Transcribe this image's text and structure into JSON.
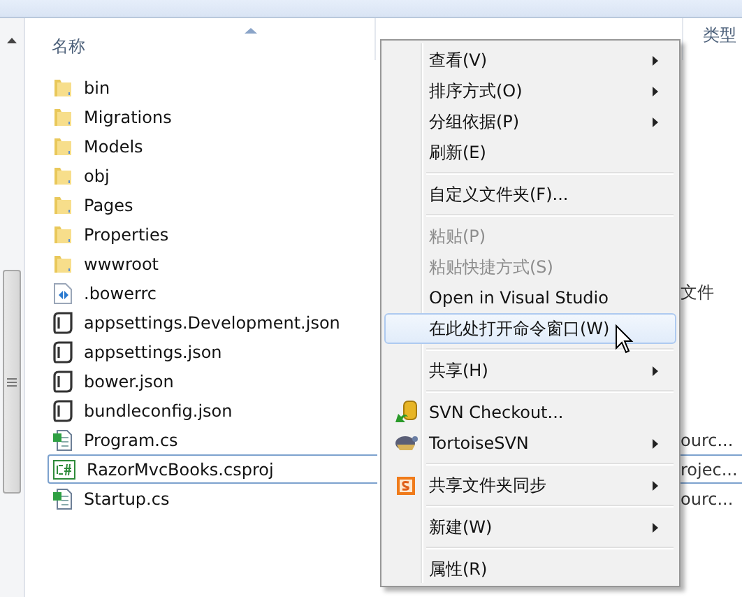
{
  "columns": [
    {
      "label": "名称",
      "kind": "name"
    },
    {
      "label": "类型",
      "kind": "type"
    }
  ],
  "files": [
    {
      "name": "bin",
      "kind": "folder",
      "selected": false
    },
    {
      "name": "Migrations",
      "kind": "folder",
      "selected": false
    },
    {
      "name": "Models",
      "kind": "folder",
      "selected": false
    },
    {
      "name": "obj",
      "kind": "folder",
      "selected": false
    },
    {
      "name": "Pages",
      "kind": "folder",
      "selected": false
    },
    {
      "name": "Properties",
      "kind": "folder",
      "selected": false
    },
    {
      "name": "wwwroot",
      "kind": "folder",
      "selected": false
    },
    {
      "name": ".bowerrc",
      "kind": "code",
      "selected": false,
      "type": "文件"
    },
    {
      "name": "appsettings.Development.json",
      "kind": "json",
      "selected": false
    },
    {
      "name": "appsettings.json",
      "kind": "json",
      "selected": false
    },
    {
      "name": "bower.json",
      "kind": "json",
      "selected": false
    },
    {
      "name": "bundleconfig.json",
      "kind": "json",
      "selected": false
    },
    {
      "name": "Program.cs",
      "kind": "csharp",
      "selected": false,
      "type": "ourc..."
    },
    {
      "name": "RazorMvcBooks.csproj",
      "kind": "csproj",
      "selected": true,
      "type": "rojec..."
    },
    {
      "name": "Startup.cs",
      "kind": "csharp",
      "selected": false,
      "type": "ourc..."
    }
  ],
  "context_menu": [
    {
      "kind": "item",
      "label": "查看(V)",
      "submenu": true,
      "disabled": false,
      "selected": false
    },
    {
      "kind": "item",
      "label": "排序方式(O)",
      "submenu": true,
      "disabled": false,
      "selected": false
    },
    {
      "kind": "item",
      "label": "分组依据(P)",
      "submenu": true,
      "disabled": false,
      "selected": false
    },
    {
      "kind": "item",
      "label": "刷新(E)",
      "submenu": false,
      "disabled": false,
      "selected": false
    },
    {
      "kind": "separator"
    },
    {
      "kind": "item",
      "label": "自定义文件夹(F)...",
      "submenu": false,
      "disabled": false,
      "selected": false
    },
    {
      "kind": "separator"
    },
    {
      "kind": "item",
      "label": "粘贴(P)",
      "submenu": false,
      "disabled": true,
      "selected": false
    },
    {
      "kind": "item",
      "label": "粘贴快捷方式(S)",
      "submenu": false,
      "disabled": true,
      "selected": false
    },
    {
      "kind": "item",
      "label": "Open in Visual Studio",
      "submenu": false,
      "disabled": false,
      "selected": false
    },
    {
      "kind": "item",
      "label": "在此处打开命令窗口(W)",
      "submenu": false,
      "disabled": false,
      "selected": true
    },
    {
      "kind": "separator"
    },
    {
      "kind": "item",
      "label": "共享(H)",
      "submenu": true,
      "disabled": false,
      "selected": false
    },
    {
      "kind": "separator"
    },
    {
      "kind": "checkout",
      "label": "SVN Checkout...",
      "submenu": false,
      "disabled": false,
      "selected": false
    },
    {
      "kind": "turtle",
      "label": "TortoiseSVN",
      "submenu": true,
      "disabled": false,
      "selected": false
    },
    {
      "kind": "separator"
    },
    {
      "kind": "sync",
      "label": "共享文件夹同步",
      "submenu": true,
      "disabled": false,
      "selected": false
    },
    {
      "kind": "separator"
    },
    {
      "kind": "item",
      "label": "新建(W)",
      "submenu": true,
      "disabled": false,
      "selected": false
    },
    {
      "kind": "separator"
    },
    {
      "kind": "item",
      "label": "属性(R)",
      "submenu": false,
      "disabled": false,
      "selected": false
    }
  ]
}
